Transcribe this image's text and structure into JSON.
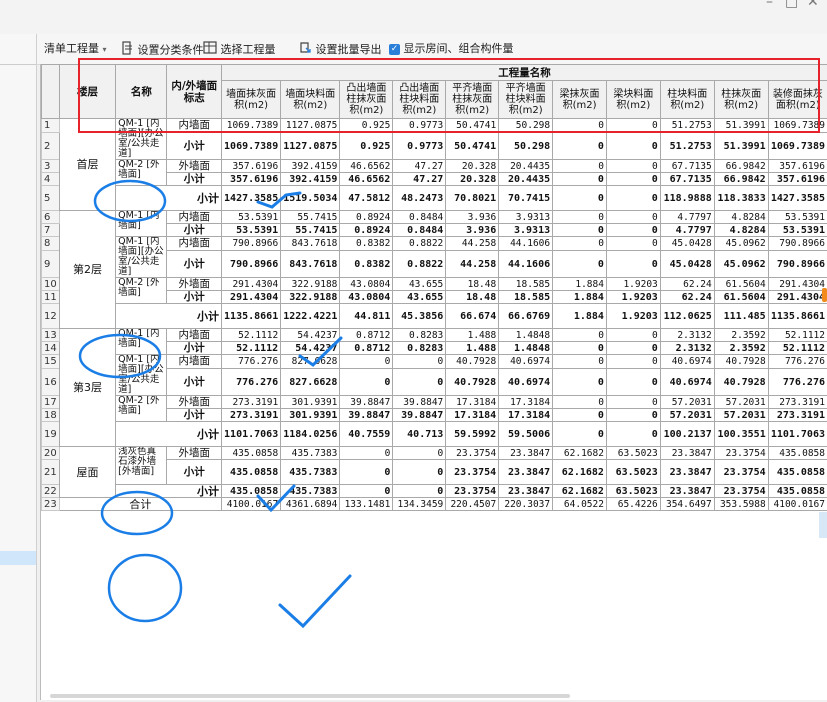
{
  "window": {
    "controls": [
      "–",
      "□",
      "✕"
    ]
  },
  "toolbar": {
    "list_dropdown": "清单工程量",
    "items": [
      {
        "label": "设置分类条件",
        "icon": "classify-icon"
      },
      {
        "label": "选择工程量",
        "icon": "select-quantity-icon"
      },
      {
        "label": "设置批量导出",
        "icon": "batch-export-icon"
      },
      {
        "label": "显示房间、组合构件量",
        "icon": "checkbox-checked-icon",
        "checked": true
      }
    ]
  },
  "grid": {
    "header": {
      "floor": "楼层",
      "name": "名称",
      "wall_flag": "内/外墙面标志",
      "group": "工程量名称",
      "columns": [
        "墙面抹灰面积(m2)",
        "墙面块料面积(m2)",
        "凸出墙面柱抹灰面积(m2)",
        "凸出墙面柱块料面积(m2)",
        "平齐墙面柱抹灰面积(m2)",
        "平齐墙面柱块料面积(m2)",
        "梁抹灰面积(m2)",
        "梁块料面积(m2)",
        "柱块料面积(m2)",
        "柱抹灰面积(m2)",
        "装修面抹灰面积(m2)"
      ]
    },
    "rows": [
      {
        "rn": "1",
        "floor": "首层",
        "floor_span": 5,
        "name": "QM-1 [内墙面][办公室/公共走道]",
        "name_span": 2,
        "type": "内墙面",
        "vals": [
          "1069.7389",
          "1127.0875",
          "0.925",
          "0.9773",
          "50.4741",
          "50.298",
          "0",
          "0",
          "51.2753",
          "51.3991",
          "1069.7389"
        ]
      },
      {
        "rn": "2",
        "type": "小计",
        "bold": true,
        "tall": true,
        "vals": [
          "1069.7389",
          "1127.0875",
          "0.925",
          "0.9773",
          "50.4741",
          "50.298",
          "0",
          "0",
          "51.2753",
          "51.3991",
          "1069.7389"
        ]
      },
      {
        "rn": "3",
        "name": "QM-2 [外墙面]",
        "name_span": 2,
        "type": "外墙面",
        "vals": [
          "357.6196",
          "392.4159",
          "46.6562",
          "47.27",
          "20.328",
          "20.4435",
          "0",
          "0",
          "67.7135",
          "66.9842",
          "357.6196"
        ]
      },
      {
        "rn": "4",
        "type": "小计",
        "bold": true,
        "vals": [
          "357.6196",
          "392.4159",
          "46.6562",
          "47.27",
          "20.328",
          "20.4435",
          "0",
          "0",
          "67.7135",
          "66.9842",
          "357.6196"
        ]
      },
      {
        "rn": "5",
        "subtotal": "小计",
        "bold": true,
        "tall": true,
        "vals": [
          "1427.3585",
          "1519.5034",
          "47.5812",
          "48.2473",
          "70.8021",
          "70.7415",
          "0",
          "0",
          "118.9888",
          "118.3833",
          "1427.3585"
        ]
      },
      {
        "rn": "6",
        "floor": "第2层",
        "floor_span": 7,
        "name": "QM-1 [内墙面]",
        "name_span": 2,
        "type": "内墙面",
        "vals": [
          "53.5391",
          "55.7415",
          "0.8924",
          "0.8484",
          "3.936",
          "3.9313",
          "0",
          "0",
          "4.7797",
          "4.8284",
          "53.5391"
        ]
      },
      {
        "rn": "7",
        "type": "小计",
        "bold": true,
        "vals": [
          "53.5391",
          "55.7415",
          "0.8924",
          "0.8484",
          "3.936",
          "3.9313",
          "0",
          "0",
          "4.7797",
          "4.8284",
          "53.5391"
        ]
      },
      {
        "rn": "8",
        "name": "QM-1 [内墙面][办公室/公共走道]",
        "name_span": 2,
        "type": "内墙面",
        "vals": [
          "790.8966",
          "843.7618",
          "0.8382",
          "0.8822",
          "44.258",
          "44.1606",
          "0",
          "0",
          "45.0428",
          "45.0962",
          "790.8966"
        ]
      },
      {
        "rn": "9",
        "type": "小计",
        "bold": true,
        "tall": true,
        "vals": [
          "790.8966",
          "843.7618",
          "0.8382",
          "0.8822",
          "44.258",
          "44.1606",
          "0",
          "0",
          "45.0428",
          "45.0962",
          "790.8966"
        ]
      },
      {
        "rn": "10",
        "name": "QM-2 [外墙面]",
        "name_span": 2,
        "type": "外墙面",
        "vals": [
          "291.4304",
          "322.9188",
          "43.0804",
          "43.655",
          "18.48",
          "18.585",
          "1.884",
          "1.9203",
          "62.24",
          "61.5604",
          "291.4304"
        ]
      },
      {
        "rn": "11",
        "type": "小计",
        "bold": true,
        "vals": [
          "291.4304",
          "322.9188",
          "43.0804",
          "43.655",
          "18.48",
          "18.585",
          "1.884",
          "1.9203",
          "62.24",
          "61.5604",
          "291.4304"
        ]
      },
      {
        "rn": "12",
        "subtotal": "小计",
        "bold": true,
        "tall": true,
        "vals": [
          "1135.8661",
          "1222.4221",
          "44.811",
          "45.3856",
          "66.674",
          "66.6769",
          "1.884",
          "1.9203",
          "112.0625",
          "111.485",
          "1135.8661"
        ]
      },
      {
        "rn": "13",
        "floor": "第3层",
        "floor_span": 7,
        "name": "QM-1 [内墙面]",
        "name_span": 2,
        "type": "内墙面",
        "vals": [
          "52.1112",
          "54.4237",
          "0.8712",
          "0.8283",
          "1.488",
          "1.4848",
          "0",
          "0",
          "2.3132",
          "2.3592",
          "52.1112"
        ]
      },
      {
        "rn": "14",
        "type": "小计",
        "bold": true,
        "vals": [
          "52.1112",
          "54.4237",
          "0.8712",
          "0.8283",
          "1.488",
          "1.4848",
          "0",
          "0",
          "2.3132",
          "2.3592",
          "52.1112"
        ]
      },
      {
        "rn": "15",
        "name": "QM-1 [内墙面][办公室/公共走道]",
        "name_span": 2,
        "type": "内墙面",
        "vals": [
          "776.276",
          "827.6628",
          "0",
          "0",
          "40.7928",
          "40.6974",
          "0",
          "0",
          "40.6974",
          "40.7928",
          "776.276"
        ]
      },
      {
        "rn": "16",
        "type": "小计",
        "bold": true,
        "tall": true,
        "vals": [
          "776.276",
          "827.6628",
          "0",
          "0",
          "40.7928",
          "40.6974",
          "0",
          "0",
          "40.6974",
          "40.7928",
          "776.276"
        ]
      },
      {
        "rn": "17",
        "name": "QM-2 [外墙面]",
        "name_span": 2,
        "type": "外墙面",
        "vals": [
          "273.3191",
          "301.9391",
          "39.8847",
          "39.8847",
          "17.3184",
          "17.3184",
          "0",
          "0",
          "57.2031",
          "57.2031",
          "273.3191"
        ]
      },
      {
        "rn": "18",
        "type": "小计",
        "bold": true,
        "vals": [
          "273.3191",
          "301.9391",
          "39.8847",
          "39.8847",
          "17.3184",
          "17.3184",
          "0",
          "0",
          "57.2031",
          "57.2031",
          "273.3191"
        ]
      },
      {
        "rn": "19",
        "subtotal": "小计",
        "bold": true,
        "tall": true,
        "vals": [
          "1101.7063",
          "1184.0256",
          "40.7559",
          "40.713",
          "59.5992",
          "59.5006",
          "0",
          "0",
          "100.2137",
          "100.3551",
          "1101.7063"
        ]
      },
      {
        "rn": "20",
        "floor": "屋面",
        "floor_span": 3,
        "name": "浅灰色真石漆外墙[外墙面]",
        "name_span": 2,
        "type": "外墙面",
        "vals": [
          "435.0858",
          "435.7383",
          "0",
          "0",
          "23.3754",
          "23.3847",
          "62.1682",
          "63.5023",
          "23.3847",
          "23.3754",
          "435.0858"
        ]
      },
      {
        "rn": "21",
        "type": "小计",
        "bold": true,
        "tall": true,
        "vals": [
          "435.0858",
          "435.7383",
          "0",
          "0",
          "23.3754",
          "23.3847",
          "62.1682",
          "63.5023",
          "23.3847",
          "23.3754",
          "435.0858"
        ]
      },
      {
        "rn": "22",
        "subtotal": "小计",
        "bold": true,
        "vals": [
          "435.0858",
          "435.7383",
          "0",
          "0",
          "23.3754",
          "23.3847",
          "62.1682",
          "63.5023",
          "23.3847",
          "23.3754",
          "435.0858"
        ]
      },
      {
        "rn": "23",
        "total": "合计",
        "vals": [
          "4100.0167",
          "4361.6894",
          "133.1481",
          "134.3459",
          "220.4507",
          "220.3037",
          "64.0522",
          "65.4226",
          "354.6497",
          "353.5988",
          "4100.0167"
        ]
      }
    ]
  },
  "colors": {
    "highlight_box": "#e8222a",
    "pen_marks": "#1a7ee6"
  }
}
